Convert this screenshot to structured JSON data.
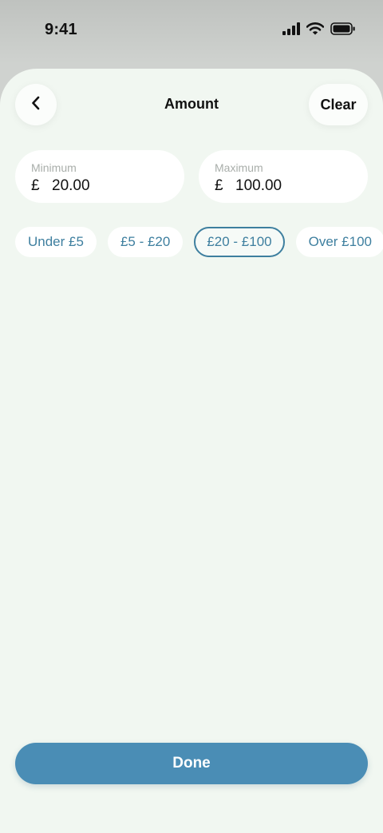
{
  "status_bar": {
    "time": "9:41",
    "icons": [
      "signal-icon",
      "wifi-icon",
      "battery-icon"
    ]
  },
  "header": {
    "title": "Amount",
    "back_icon": "chevron-left-icon",
    "clear_label": "Clear"
  },
  "amount": {
    "minimum": {
      "label": "Minimum",
      "currency": "£",
      "value": "20.00"
    },
    "maximum": {
      "label": "Maximum",
      "currency": "£",
      "value": "100.00"
    }
  },
  "ranges": [
    {
      "label": "Under £5",
      "selected": false
    },
    {
      "label": "£5 - £20",
      "selected": false
    },
    {
      "label": "£20 - £100",
      "selected": true
    },
    {
      "label": "Over £100",
      "selected": false
    }
  ],
  "footer": {
    "done_label": "Done"
  },
  "colors": {
    "accent": "#4a8db5",
    "chip_text": "#3e7f9f",
    "sheet_background": "#f1f7f1"
  }
}
